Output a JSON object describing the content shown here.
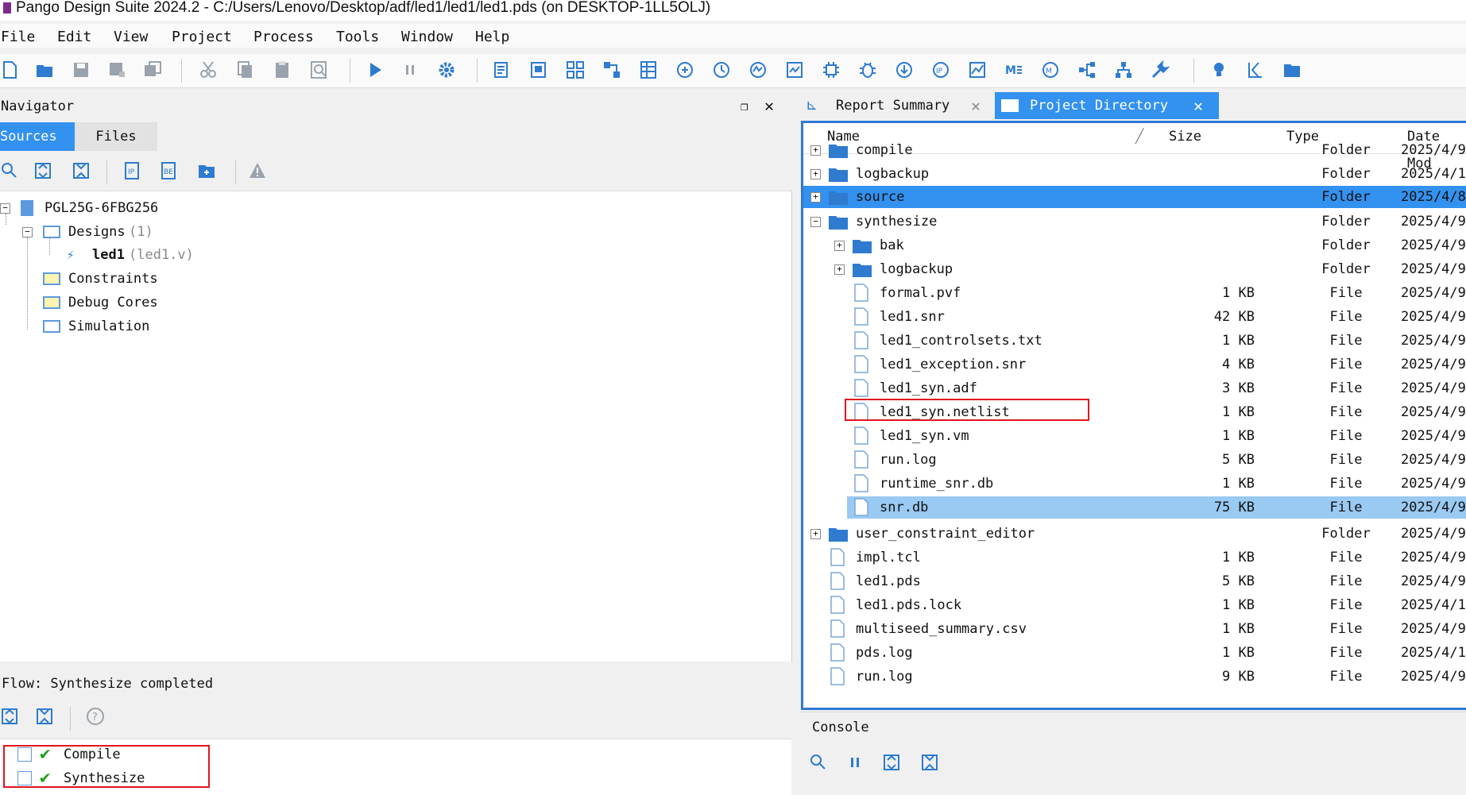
{
  "window": {
    "title": "Pango Design Suite 2024.2 - C:/Users/Lenovo/Desktop/adf/led1/led1/led1.pds (on DESKTOP-1LL5OLJ)"
  },
  "menu": [
    "File",
    "Edit",
    "View",
    "Project",
    "Process",
    "Tools",
    "Window",
    "Help"
  ],
  "navigator": {
    "title": "Navigator",
    "tabs": [
      "Sources",
      "Files"
    ],
    "device": "PGL25G-6FBG256",
    "designs_label": "Designs",
    "designs_count": "(1)",
    "top_module": "led1",
    "top_module_file": "(led1.v)",
    "constraints": "Constraints",
    "debug_cores": "Debug Cores",
    "simulation": "Simulation"
  },
  "flow": {
    "status": "Flow: Synthesize completed",
    "steps": [
      "Compile",
      "Synthesize"
    ]
  },
  "tabs": [
    "Report Summary",
    "Project Directory"
  ],
  "directory": {
    "columns": [
      "Name",
      "Size",
      "Type",
      "Date Mod"
    ],
    "rows": [
      {
        "name": "compile",
        "size": "",
        "type": "Folder",
        "date": "2025/4/9"
      },
      {
        "name": "logbackup",
        "size": "",
        "type": "Folder",
        "date": "2025/4/1"
      },
      {
        "name": "source",
        "size": "",
        "type": "Folder",
        "date": "2025/4/8"
      },
      {
        "name": "synthesize",
        "size": "",
        "type": "Folder",
        "date": "2025/4/9"
      },
      {
        "name": "bak",
        "size": "",
        "type": "Folder",
        "date": "2025/4/9"
      },
      {
        "name": "logbackup",
        "size": "",
        "type": "Folder",
        "date": "2025/4/9"
      },
      {
        "name": "formal.pvf",
        "size": "1 KB",
        "type": "File",
        "date": "2025/4/9"
      },
      {
        "name": "led1.snr",
        "size": "42 KB",
        "type": "File",
        "date": "2025/4/9"
      },
      {
        "name": "led1_controlsets.txt",
        "size": "1 KB",
        "type": "File",
        "date": "2025/4/9"
      },
      {
        "name": "led1_exception.snr",
        "size": "4 KB",
        "type": "File",
        "date": "2025/4/9"
      },
      {
        "name": "led1_syn.adf",
        "size": "3 KB",
        "type": "File",
        "date": "2025/4/9"
      },
      {
        "name": "led1_syn.netlist",
        "size": "1 KB",
        "type": "File",
        "date": "2025/4/9"
      },
      {
        "name": "led1_syn.vm",
        "size": "1 KB",
        "type": "File",
        "date": "2025/4/9"
      },
      {
        "name": "run.log",
        "size": "5 KB",
        "type": "File",
        "date": "2025/4/9"
      },
      {
        "name": "runtime_snr.db",
        "size": "1 KB",
        "type": "File",
        "date": "2025/4/9"
      },
      {
        "name": "snr.db",
        "size": "75 KB",
        "type": "File",
        "date": "2025/4/9"
      },
      {
        "name": "user_constraint_editor",
        "size": "",
        "type": "Folder",
        "date": "2025/4/9"
      },
      {
        "name": "impl.tcl",
        "size": "1 KB",
        "type": "File",
        "date": "2025/4/9"
      },
      {
        "name": "led1.pds",
        "size": "5 KB",
        "type": "File",
        "date": "2025/4/9"
      },
      {
        "name": "led1.pds.lock",
        "size": "1 KB",
        "type": "File",
        "date": "2025/4/1"
      },
      {
        "name": "multiseed_summary.csv",
        "size": "1 KB",
        "type": "File",
        "date": "2025/4/9"
      },
      {
        "name": "pds.log",
        "size": "1 KB",
        "type": "File",
        "date": "2025/4/1"
      },
      {
        "name": "run.log",
        "size": "9 KB",
        "type": "File",
        "date": "2025/4/9"
      }
    ]
  },
  "console": {
    "title": "Console"
  },
  "colors": {
    "selection": "#3391ef",
    "selection_light": "#9ac9f2",
    "accent": "#2e7bcf",
    "highlight_box": "#e0141e",
    "check": "#1aa11a"
  }
}
